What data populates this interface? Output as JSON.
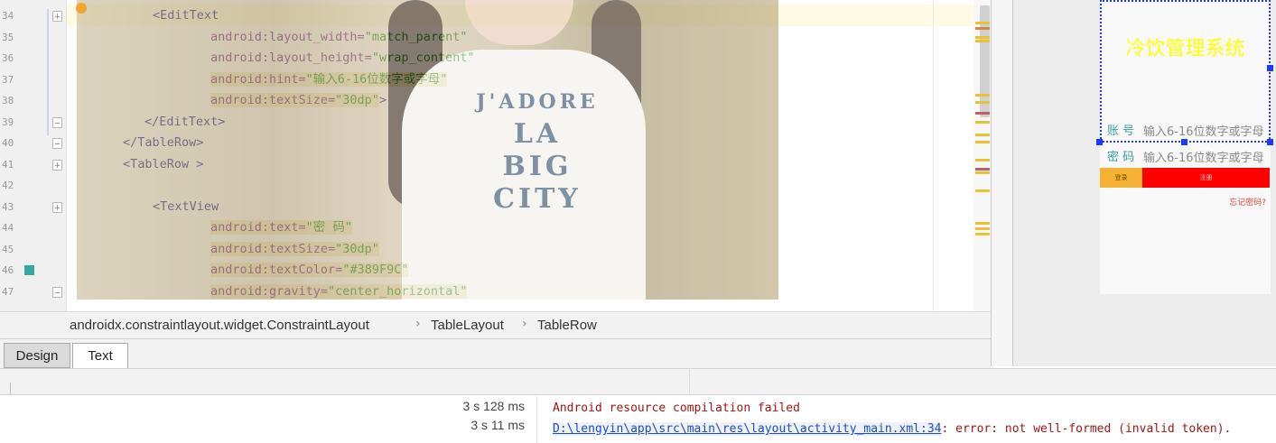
{
  "editor": {
    "line_numbers": [
      "34",
      "35",
      "36",
      "37",
      "38",
      "39",
      "40",
      "41",
      "42",
      "43",
      "44",
      "45",
      "46",
      "47"
    ],
    "lines": [
      {
        "indent": 3,
        "parts": [
          {
            "t": "<",
            "c": "tag"
          },
          {
            "t": "EditText",
            "c": "tag"
          }
        ]
      },
      {
        "indent": 5,
        "parts": [
          {
            "t": "android:layout_width=",
            "c": "attr"
          },
          {
            "t": "\"match_parent\"",
            "c": "val"
          }
        ]
      },
      {
        "indent": 5,
        "parts": [
          {
            "t": "android:layout_height=",
            "c": "attr"
          },
          {
            "t": "\"wrap_content\"",
            "c": "val"
          }
        ]
      },
      {
        "indent": 5,
        "parts": [
          {
            "t": "android:hint=",
            "c": "attr bg"
          },
          {
            "t": "\"输入6-16位数字或字母\"",
            "c": "val bg"
          }
        ]
      },
      {
        "indent": 5,
        "parts": [
          {
            "t": "android:textSize=",
            "c": "attr bg"
          },
          {
            "t": "\"30dp\"",
            "c": "val bg"
          },
          {
            "t": ">",
            "c": "tag"
          }
        ]
      },
      {
        "indent": 2,
        "parts": [
          {
            "t": "</EditText>",
            "c": "tag"
          }
        ]
      },
      {
        "indent": 2,
        "parts": [
          {
            "t": "</TableRow>",
            "c": "tag"
          }
        ]
      },
      {
        "indent": 2,
        "parts": [
          {
            "t": "<TableRow >",
            "c": "tag"
          }
        ]
      },
      {
        "indent": 0,
        "parts": []
      },
      {
        "indent": 3,
        "parts": [
          {
            "t": "<TextView",
            "c": "tag"
          }
        ]
      },
      {
        "indent": 5,
        "parts": [
          {
            "t": "android:text=",
            "c": "attr bg"
          },
          {
            "t": "\"密 码\"",
            "c": "val bg"
          }
        ]
      },
      {
        "indent": 5,
        "parts": [
          {
            "t": "android:textSize=",
            "c": "attr bg"
          },
          {
            "t": "\"30dp\"",
            "c": "val bg"
          }
        ]
      },
      {
        "indent": 5,
        "parts": [
          {
            "t": "android:textColor=",
            "c": "attr bg"
          },
          {
            "t": "\"#389F9C\"",
            "c": "val bg"
          }
        ]
      },
      {
        "indent": 5,
        "parts": [
          {
            "t": "android:gravity=",
            "c": "attr bg"
          },
          {
            "t": "\"center_horizontal\"",
            "c": "val bg"
          }
        ]
      }
    ],
    "photo_print": [
      "J'ADORE",
      "LA",
      "BIG",
      "CITY"
    ]
  },
  "breadcrumb": {
    "items": [
      "androidx.constraintlayout.widget.ConstraintLayout",
      "TableLayout",
      "TableRow"
    ]
  },
  "tabs": {
    "design": "Design",
    "text": "Text"
  },
  "preview": {
    "app_title": "冷饮管理系统",
    "account_label": "账 号",
    "password_label": "密 码",
    "hint": "输入6-16位数字或字母",
    "login_button": "登录",
    "register_button": "注册",
    "forgot": "忘记密码?",
    "title_color": "#ffff00",
    "label_color": "#389F9C"
  },
  "build": {
    "times": [
      "3 s 128 ms",
      "3 s 11 ms"
    ],
    "error_title": "Android resource compilation failed",
    "error_path": "D:\\lengyin\\app\\src\\main\\res\\layout\\activity_main.xml:34",
    "error_message": ": error: not well-formed (invalid token)."
  }
}
